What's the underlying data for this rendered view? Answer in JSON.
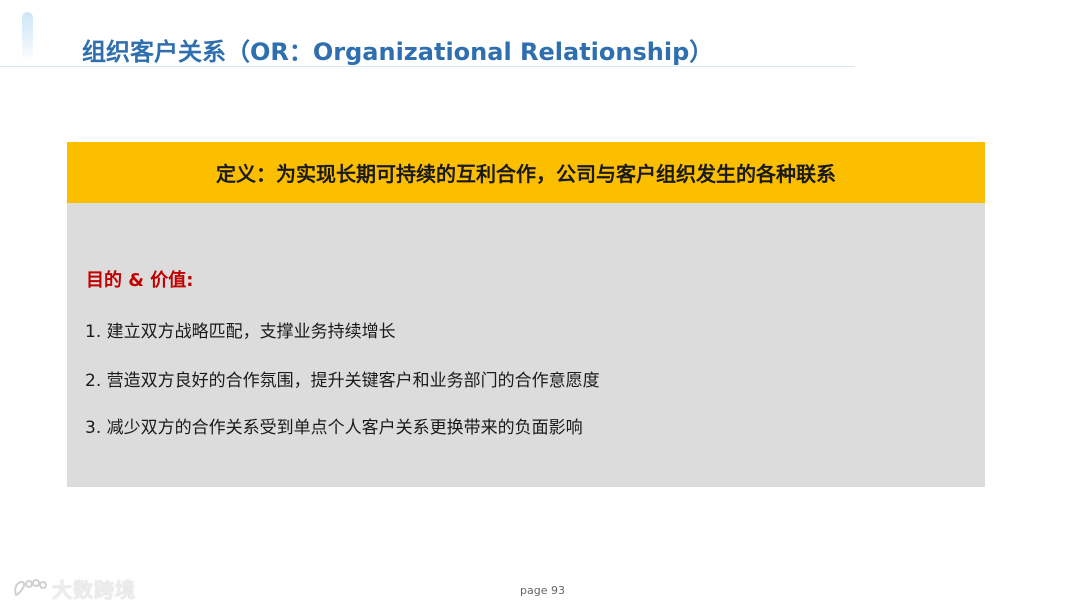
{
  "slide": {
    "title": "组织客户关系（OR：Organizational Relationship）",
    "definition": "定义：为实现长期可持续的互利合作，公司与客户组织发生的各种联系",
    "purpose_heading": "目的 & 价值:",
    "points": [
      "1. 建立双方战略匹配，支撑业务持续增长",
      "2. 营造双方良好的合作氛围，提升关键客户和业务部门的合作意愿度",
      "3. 减少双方的合作关系受到单点个人客户关系更换带来的负面影响"
    ],
    "page_label": "page 93"
  },
  "watermark": {
    "text": "大数跨境",
    "icon": "paw-logo-icon"
  },
  "colors": {
    "title": "#2f6fb0",
    "definition_bar": "#fbbf00",
    "content_box": "#dcdcdc",
    "heading_red": "#c00000"
  }
}
